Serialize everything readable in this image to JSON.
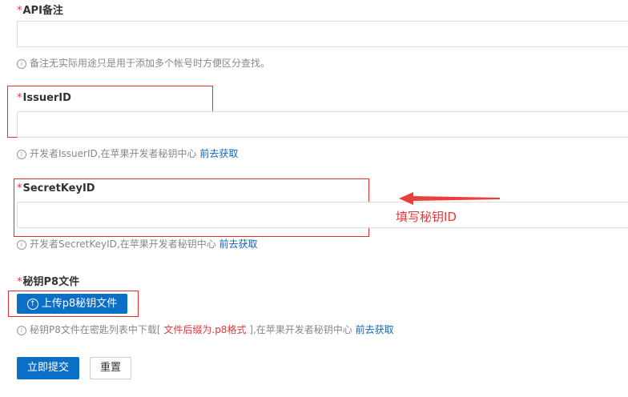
{
  "fields": {
    "api_note": {
      "required_mark": "*",
      "label": "API备注",
      "value": "",
      "hint": "备注无实际用途只是用于添加多个帐号时方便区分查找。"
    },
    "issuer_id": {
      "required_mark": "*",
      "label": "IssuerID",
      "value": "",
      "hint": "开发者IssuerID,在苹果开发者秘钥中心",
      "link": "前去获取"
    },
    "secret_key_id": {
      "required_mark": "*",
      "label": "SecretKeyID",
      "value": "",
      "hint": "开发者SecretKeyID,在苹果开发者秘钥中心",
      "link": "前去获取"
    },
    "p8_file": {
      "required_mark": "*",
      "label": "秘钥P8文件",
      "upload_label": "上传p8秘钥文件",
      "hint_prefix": "秘钥P8文件在密匙列表中下载[",
      "hint_red": " 文件后缀为.p8格式 ",
      "hint_suffix": "],在苹果开发者秘钥中心",
      "link": "前去获取"
    }
  },
  "actions": {
    "submit_label": "立即提交",
    "reset_label": "重置"
  },
  "annotation": {
    "text": "填写秘钥ID",
    "color": "#e4393c"
  },
  "colors": {
    "primary": "#0b6fc6",
    "link": "#0b66c3",
    "required": "#e4393c",
    "highlight_box": "#e03030"
  },
  "icons": {
    "info": "info-circle-icon",
    "upload": "upload-circle-icon",
    "arrow": "arrow-left-icon"
  }
}
